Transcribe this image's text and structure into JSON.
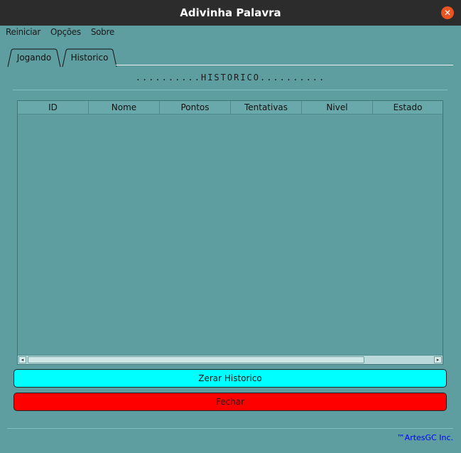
{
  "window": {
    "title": "Adivinha Palavra"
  },
  "menu": {
    "items": [
      "Reiniciar",
      "Opções",
      "Sobre"
    ]
  },
  "tabs": [
    {
      "label": "Jogando",
      "selected": false
    },
    {
      "label": "Historico",
      "selected": true
    }
  ],
  "heading": "..........HISTORICO..........",
  "table": {
    "columns": [
      "ID",
      "Nome",
      "Pontos",
      "Tentativas",
      "Nivel",
      "Estado"
    ],
    "rows": []
  },
  "buttons": {
    "zerar": "Zerar Historico",
    "fechar": "Fechar"
  },
  "footer": "™ArtesGC Inc.",
  "colors": {
    "background": "#5f9ea0",
    "zerar_button": "#00ffff",
    "fechar_button": "#ff0000",
    "footer_text": "#0000ff"
  }
}
